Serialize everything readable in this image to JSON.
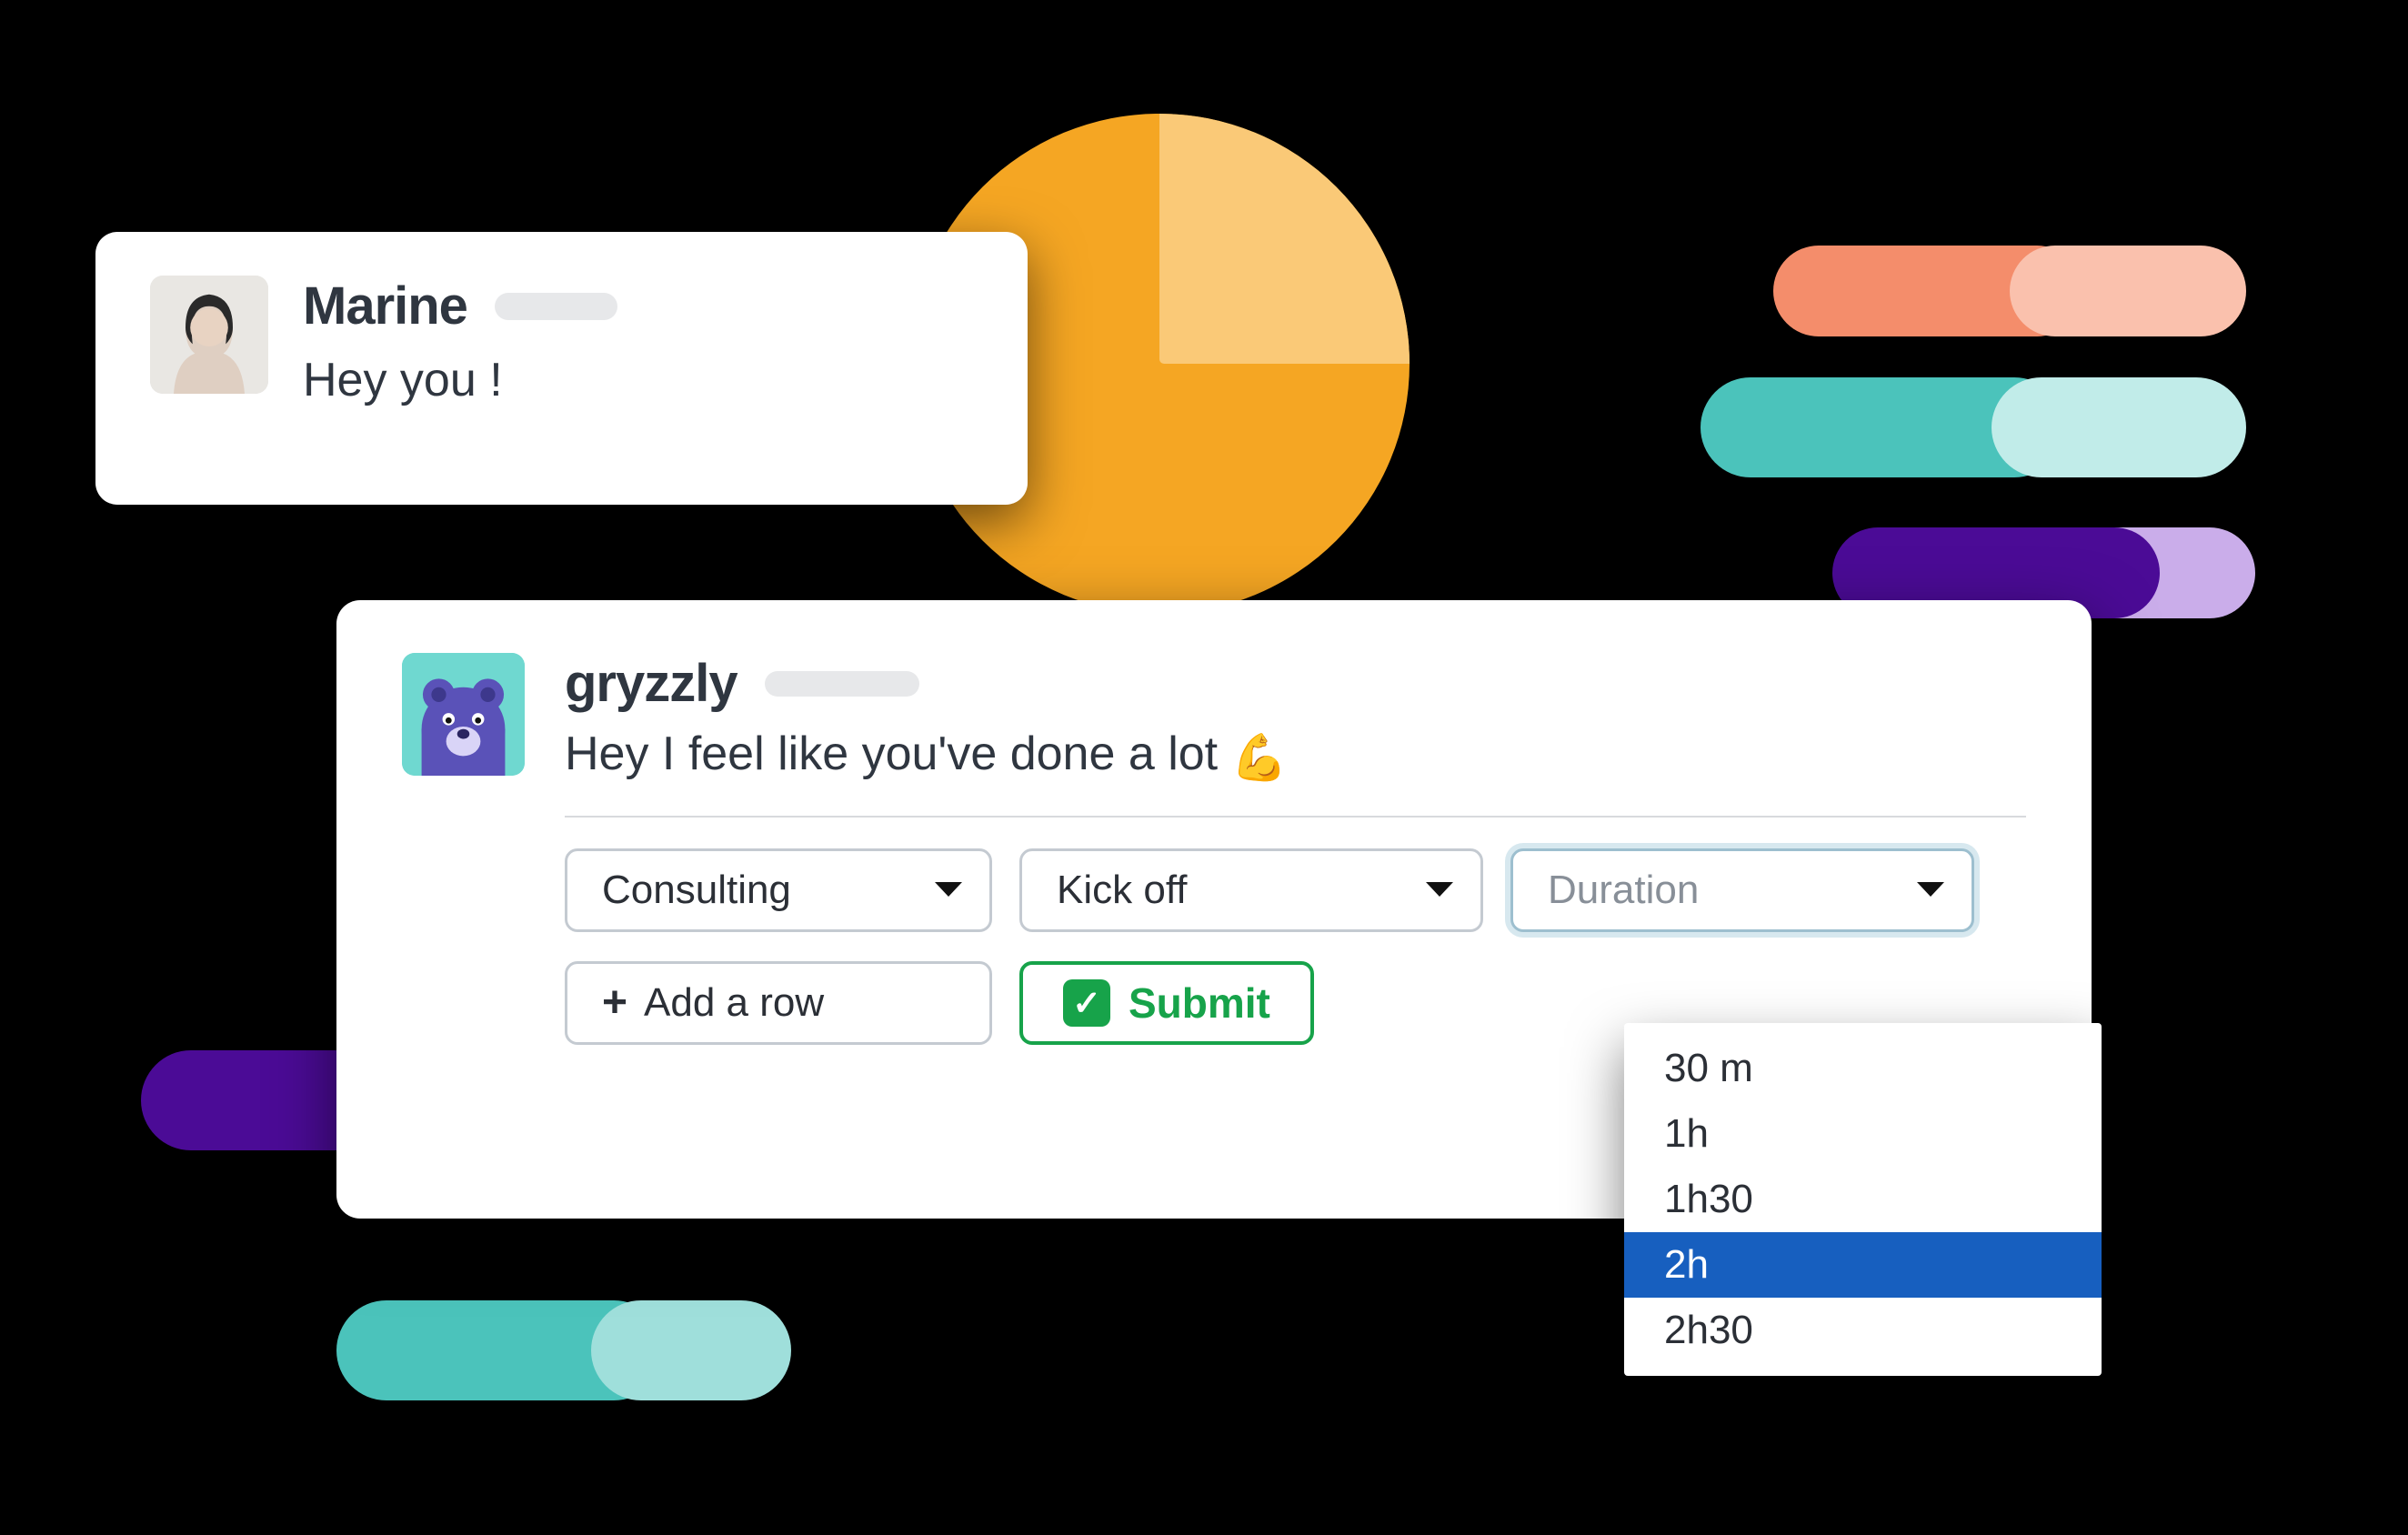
{
  "card1": {
    "name": "Marine",
    "message": "Hey you !"
  },
  "card2": {
    "name": "gryzzly",
    "message": "Hey I feel like you've done a lot ",
    "emoji": "💪",
    "selects": {
      "project": "Consulting",
      "task": "Kick off",
      "duration_placeholder": "Duration"
    },
    "add_row_label": "Add a row",
    "submit_label": "Submit"
  },
  "duration_menu": {
    "options": [
      "30 m",
      "1h",
      "1h30",
      "2h",
      "2h30"
    ],
    "selected_index": 3
  },
  "colors": {
    "orange": "#F5A623",
    "coral": "#f48d6b",
    "teal": "#4bc3bb",
    "violet": "#4b0b96",
    "submit_green": "#17a34a",
    "menu_blue": "#175fbf"
  }
}
